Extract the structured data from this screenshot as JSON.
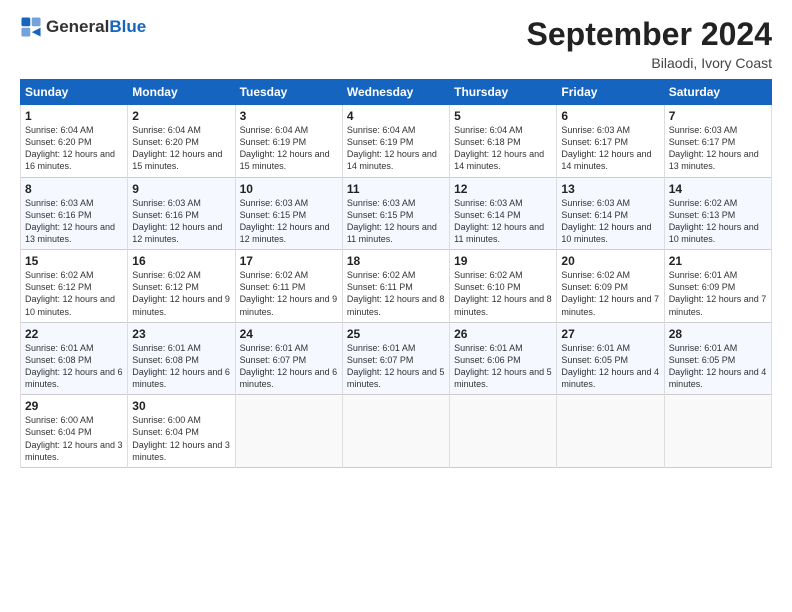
{
  "header": {
    "logo_general": "General",
    "logo_blue": "Blue",
    "month": "September 2024",
    "location": "Bilaodi, Ivory Coast"
  },
  "days_of_week": [
    "Sunday",
    "Monday",
    "Tuesday",
    "Wednesday",
    "Thursday",
    "Friday",
    "Saturday"
  ],
  "weeks": [
    [
      {
        "num": "1",
        "sunrise": "6:04 AM",
        "sunset": "6:20 PM",
        "daylight": "12 hours and 16 minutes."
      },
      {
        "num": "2",
        "sunrise": "6:04 AM",
        "sunset": "6:20 PM",
        "daylight": "12 hours and 15 minutes."
      },
      {
        "num": "3",
        "sunrise": "6:04 AM",
        "sunset": "6:19 PM",
        "daylight": "12 hours and 15 minutes."
      },
      {
        "num": "4",
        "sunrise": "6:04 AM",
        "sunset": "6:19 PM",
        "daylight": "12 hours and 14 minutes."
      },
      {
        "num": "5",
        "sunrise": "6:04 AM",
        "sunset": "6:18 PM",
        "daylight": "12 hours and 14 minutes."
      },
      {
        "num": "6",
        "sunrise": "6:03 AM",
        "sunset": "6:17 PM",
        "daylight": "12 hours and 14 minutes."
      },
      {
        "num": "7",
        "sunrise": "6:03 AM",
        "sunset": "6:17 PM",
        "daylight": "12 hours and 13 minutes."
      }
    ],
    [
      {
        "num": "8",
        "sunrise": "6:03 AM",
        "sunset": "6:16 PM",
        "daylight": "12 hours and 13 minutes."
      },
      {
        "num": "9",
        "sunrise": "6:03 AM",
        "sunset": "6:16 PM",
        "daylight": "12 hours and 12 minutes."
      },
      {
        "num": "10",
        "sunrise": "6:03 AM",
        "sunset": "6:15 PM",
        "daylight": "12 hours and 12 minutes."
      },
      {
        "num": "11",
        "sunrise": "6:03 AM",
        "sunset": "6:15 PM",
        "daylight": "12 hours and 11 minutes."
      },
      {
        "num": "12",
        "sunrise": "6:03 AM",
        "sunset": "6:14 PM",
        "daylight": "12 hours and 11 minutes."
      },
      {
        "num": "13",
        "sunrise": "6:03 AM",
        "sunset": "6:14 PM",
        "daylight": "12 hours and 10 minutes."
      },
      {
        "num": "14",
        "sunrise": "6:02 AM",
        "sunset": "6:13 PM",
        "daylight": "12 hours and 10 minutes."
      }
    ],
    [
      {
        "num": "15",
        "sunrise": "6:02 AM",
        "sunset": "6:12 PM",
        "daylight": "12 hours and 10 minutes."
      },
      {
        "num": "16",
        "sunrise": "6:02 AM",
        "sunset": "6:12 PM",
        "daylight": "12 hours and 9 minutes."
      },
      {
        "num": "17",
        "sunrise": "6:02 AM",
        "sunset": "6:11 PM",
        "daylight": "12 hours and 9 minutes."
      },
      {
        "num": "18",
        "sunrise": "6:02 AM",
        "sunset": "6:11 PM",
        "daylight": "12 hours and 8 minutes."
      },
      {
        "num": "19",
        "sunrise": "6:02 AM",
        "sunset": "6:10 PM",
        "daylight": "12 hours and 8 minutes."
      },
      {
        "num": "20",
        "sunrise": "6:02 AM",
        "sunset": "6:09 PM",
        "daylight": "12 hours and 7 minutes."
      },
      {
        "num": "21",
        "sunrise": "6:01 AM",
        "sunset": "6:09 PM",
        "daylight": "12 hours and 7 minutes."
      }
    ],
    [
      {
        "num": "22",
        "sunrise": "6:01 AM",
        "sunset": "6:08 PM",
        "daylight": "12 hours and 6 minutes."
      },
      {
        "num": "23",
        "sunrise": "6:01 AM",
        "sunset": "6:08 PM",
        "daylight": "12 hours and 6 minutes."
      },
      {
        "num": "24",
        "sunrise": "6:01 AM",
        "sunset": "6:07 PM",
        "daylight": "12 hours and 6 minutes."
      },
      {
        "num": "25",
        "sunrise": "6:01 AM",
        "sunset": "6:07 PM",
        "daylight": "12 hours and 5 minutes."
      },
      {
        "num": "26",
        "sunrise": "6:01 AM",
        "sunset": "6:06 PM",
        "daylight": "12 hours and 5 minutes."
      },
      {
        "num": "27",
        "sunrise": "6:01 AM",
        "sunset": "6:05 PM",
        "daylight": "12 hours and 4 minutes."
      },
      {
        "num": "28",
        "sunrise": "6:01 AM",
        "sunset": "6:05 PM",
        "daylight": "12 hours and 4 minutes."
      }
    ],
    [
      {
        "num": "29",
        "sunrise": "6:00 AM",
        "sunset": "6:04 PM",
        "daylight": "12 hours and 3 minutes."
      },
      {
        "num": "30",
        "sunrise": "6:00 AM",
        "sunset": "6:04 PM",
        "daylight": "12 hours and 3 minutes."
      },
      null,
      null,
      null,
      null,
      null
    ]
  ],
  "labels": {
    "sunrise": "Sunrise:",
    "sunset": "Sunset:",
    "daylight": "Daylight:"
  }
}
